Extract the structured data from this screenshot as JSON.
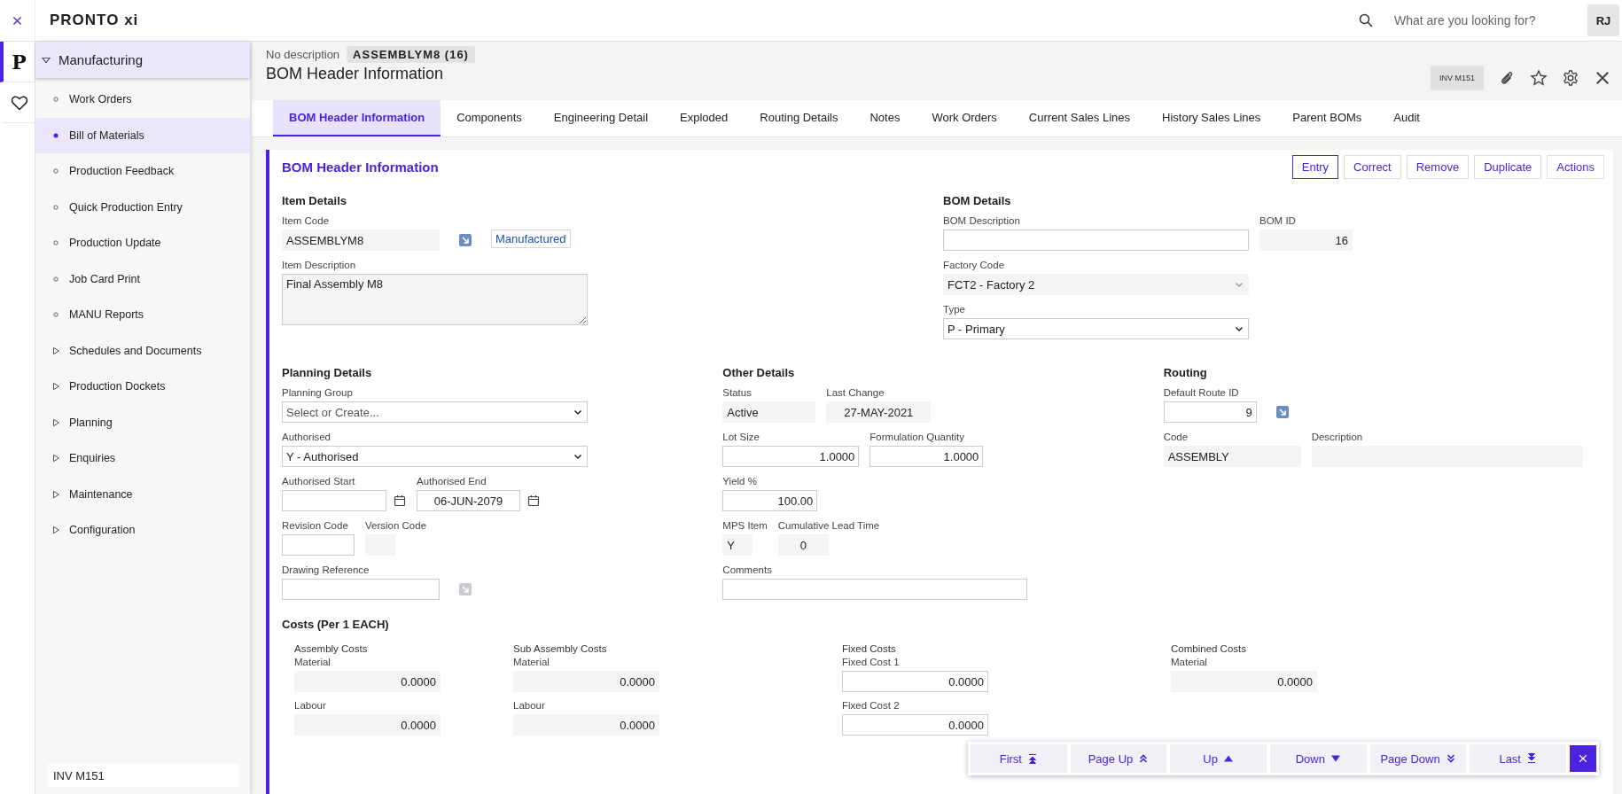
{
  "topbar": {
    "logo": "PRONTO xi",
    "search": {
      "placeholder": "What are you looking for?"
    },
    "user": "RJ"
  },
  "rail": [
    {
      "kind": "logo",
      "label": "P",
      "selected": true
    },
    {
      "kind": "favorites",
      "selected": false
    }
  ],
  "sidebar": {
    "module": {
      "label": "Manufacturing",
      "expanded": true
    },
    "items": [
      {
        "label": "Work Orders",
        "kind": "program",
        "selected": false
      },
      {
        "label": "Bill of Materials",
        "kind": "program",
        "selected": true
      },
      {
        "label": "Production Feedback",
        "kind": "program",
        "selected": false
      },
      {
        "label": "Quick Production Entry",
        "kind": "program",
        "selected": false
      },
      {
        "label": "Production Update",
        "kind": "program",
        "selected": false
      },
      {
        "label": "Job Card Print",
        "kind": "program",
        "selected": false
      },
      {
        "label": "MANU Reports",
        "kind": "program",
        "selected": false
      },
      {
        "label": "Schedules and Documents",
        "kind": "folder",
        "selected": false
      },
      {
        "label": "Production Dockets",
        "kind": "folder",
        "selected": false
      },
      {
        "label": "Planning",
        "kind": "folder",
        "selected": false
      },
      {
        "label": "Enquiries",
        "kind": "folder",
        "selected": false
      },
      {
        "label": "Maintenance",
        "kind": "folder",
        "selected": false
      },
      {
        "label": "Configuration",
        "kind": "folder",
        "selected": false
      }
    ],
    "footer": "INV M151"
  },
  "header": {
    "description": "No description",
    "record": "ASSEMBLYM8 (16)",
    "title": "BOM Header Information",
    "program": "INV M151"
  },
  "tabs": [
    {
      "label": "BOM Header Information",
      "selected": true
    },
    {
      "label": "Components",
      "selected": false
    },
    {
      "label": "Engineering Detail",
      "selected": false
    },
    {
      "label": "Exploded",
      "selected": false
    },
    {
      "label": "Routing Details",
      "selected": false
    },
    {
      "label": "Notes",
      "selected": false
    },
    {
      "label": "Work Orders",
      "selected": false
    },
    {
      "label": "Current Sales Lines",
      "selected": false
    },
    {
      "label": "History Sales Lines",
      "selected": false
    },
    {
      "label": "Parent BOMs",
      "selected": false
    },
    {
      "label": "Audit",
      "selected": false
    }
  ],
  "panel": {
    "title": "BOM Header Information",
    "actions": [
      {
        "label": "Entry",
        "selected": true
      },
      {
        "label": "Correct",
        "selected": false
      },
      {
        "label": "Remove",
        "selected": false
      },
      {
        "label": "Duplicate",
        "selected": false
      },
      {
        "label": "Actions",
        "selected": false
      }
    ],
    "sections": [
      {
        "title": "Item Details",
        "rows": [
          [
            {
              "kind": "readonly",
              "label": "Item Code",
              "value": "ASSEMBLYM8"
            },
            {
              "kind": "link",
              "disabled": false
            },
            {
              "kind": "tag",
              "value": "Manufactured"
            }
          ],
          [
            {
              "kind": "textarea",
              "label": "Item Description",
              "value": "Final Assembly M8"
            }
          ]
        ]
      },
      {
        "title": "BOM Details",
        "rows": [
          [
            {
              "kind": "input",
              "label": "BOM Description"
            },
            {
              "kind": "readonly-number",
              "label": "BOM ID",
              "value": "16"
            }
          ],
          [
            {
              "kind": "readonly-select",
              "label": "Factory Code",
              "value": "FCT2 - Factory 2"
            }
          ],
          [
            {
              "kind": "select",
              "label": "Type",
              "value": "P - Primary"
            }
          ]
        ]
      },
      {
        "title": "Planning Details",
        "rows": [
          [
            {
              "kind": "select",
              "label": "Planning Group",
              "placeholder": "Select or Create..."
            }
          ],
          [
            {
              "kind": "select",
              "label": "Authorised",
              "value": "Y - Authorised"
            }
          ],
          [
            {
              "kind": "date",
              "label": "Authorised Start"
            },
            {
              "kind": "date",
              "label": "Authorised End",
              "value": "06-JUN-2079"
            }
          ],
          [
            {
              "kind": "input",
              "label": "Revision Code"
            },
            {
              "kind": "readonly",
              "label": "Version Code"
            }
          ],
          [
            {
              "kind": "input",
              "label": "Drawing Reference"
            },
            {
              "kind": "link",
              "disabled": true
            }
          ]
        ]
      },
      {
        "title": "Other Details",
        "rows": [
          [
            {
              "kind": "readonly",
              "label": "Status",
              "value": "Active"
            },
            {
              "kind": "readonly-center",
              "label": "Last Change",
              "value": "27-MAY-2021"
            }
          ],
          [
            {
              "kind": "number",
              "label": "Lot Size",
              "value": "1.0000"
            },
            {
              "kind": "number",
              "label": "Formulation Quantity",
              "value": "1.0000"
            }
          ],
          [
            {
              "kind": "number",
              "label": "Yield %",
              "value": "100.00"
            }
          ],
          [
            {
              "kind": "readonly",
              "label": "MPS Item",
              "value": "Y"
            },
            {
              "kind": "readonly-center",
              "label": "Cumulative Lead Time",
              "value": "0"
            }
          ],
          [
            {
              "kind": "input",
              "label": "Comments"
            }
          ]
        ]
      },
      {
        "title": "Routing",
        "rows": [
          [
            {
              "kind": "number",
              "label": "Default Route ID",
              "value": "9"
            },
            {
              "kind": "link",
              "disabled": false
            }
          ],
          [
            {
              "kind": "readonly",
              "label": "Code",
              "value": "ASSEMBLY"
            },
            {
              "kind": "readonly",
              "label": "Description"
            }
          ]
        ]
      }
    ],
    "costs": {
      "title": "Costs (Per 1 EACH)",
      "groups": [
        {
          "title": "Assembly Costs",
          "fields": [
            {
              "kind": "readonly-number",
              "label": "Material",
              "value": "0.0000"
            },
            {
              "kind": "readonly-number",
              "label": "Labour",
              "value": "0.0000"
            }
          ]
        },
        {
          "title": "Sub Assembly Costs",
          "fields": [
            {
              "kind": "readonly-number",
              "label": "Material",
              "value": "0.0000"
            },
            {
              "kind": "readonly-number",
              "label": "Labour",
              "value": "0.0000"
            }
          ]
        },
        {
          "title": "Fixed Costs",
          "fields": [
            {
              "kind": "number",
              "label": "Fixed Cost 1",
              "value": "0.0000"
            },
            {
              "kind": "number",
              "label": "Fixed Cost 2",
              "value": "0.0000"
            }
          ]
        },
        {
          "title": "Combined Costs",
          "fields": [
            {
              "kind": "readonly-number",
              "label": "Material",
              "value": "0.0000"
            }
          ]
        }
      ]
    }
  },
  "navigation": [
    {
      "label": "First",
      "kind": "first"
    },
    {
      "label": "Page Up",
      "kind": "page-up"
    },
    {
      "label": "Up",
      "kind": "up"
    },
    {
      "label": "Down",
      "kind": "down"
    },
    {
      "label": "Page Down",
      "kind": "page-down"
    },
    {
      "label": "Last",
      "kind": "last"
    }
  ]
}
